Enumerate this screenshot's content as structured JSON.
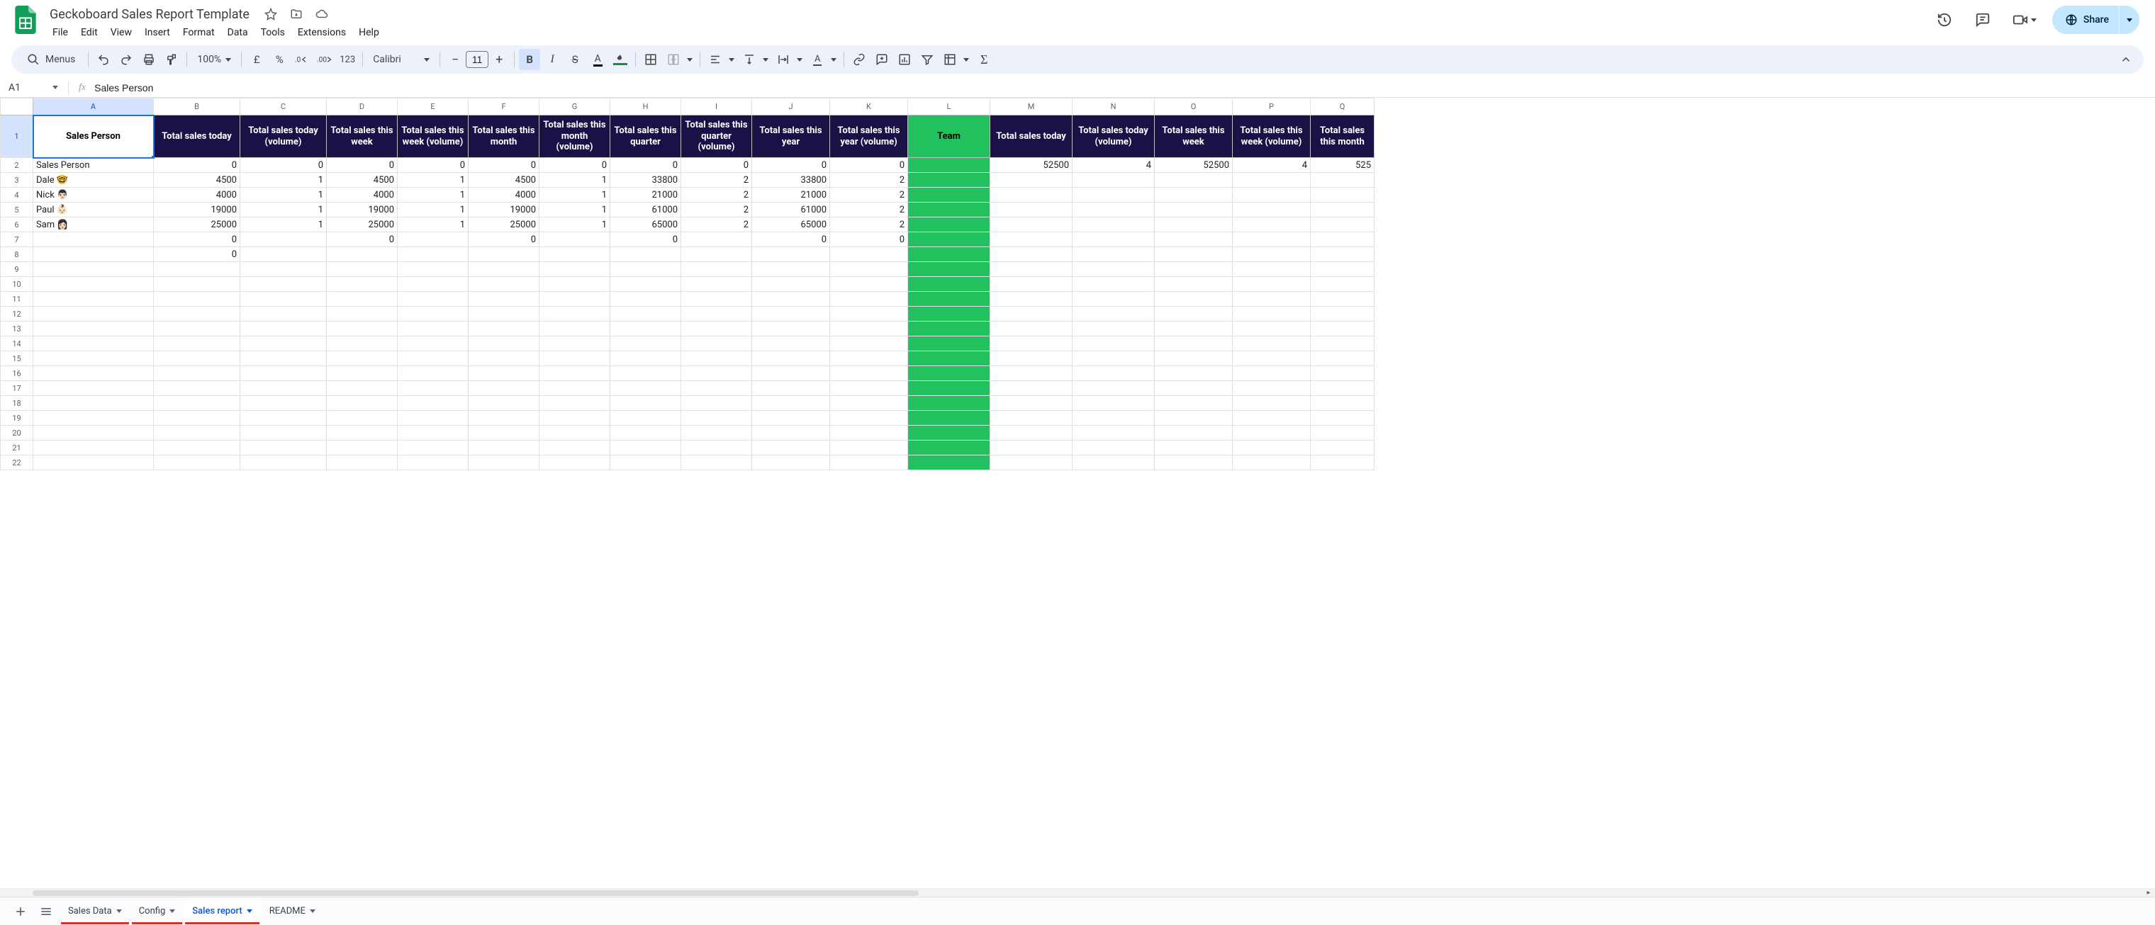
{
  "doc": {
    "title": "Geckoboard Sales Report Template"
  },
  "menus": [
    "File",
    "Edit",
    "View",
    "Insert",
    "Format",
    "Data",
    "Tools",
    "Extensions",
    "Help"
  ],
  "share": {
    "label": "Share"
  },
  "toolbar": {
    "search": "Menus",
    "zoom": "100%",
    "currency": "£",
    "percent": "%",
    "format123": "123",
    "font": "Calibri",
    "font_size": "11"
  },
  "name_box": "A1",
  "formula": "Sales Person",
  "columns": [
    {
      "letter": "A",
      "width": 170,
      "class": "hdr-green",
      "label": "Sales Person"
    },
    {
      "letter": "B",
      "width": 122,
      "class": "hdr-dark",
      "label": "Total sales today"
    },
    {
      "letter": "C",
      "width": 122,
      "class": "hdr-dark",
      "label": "Total sales today (volume)"
    },
    {
      "letter": "D",
      "width": 100,
      "class": "hdr-dark",
      "label": "Total sales this week"
    },
    {
      "letter": "E",
      "width": 100,
      "class": "hdr-dark",
      "label": "Total sales this week (volume)"
    },
    {
      "letter": "F",
      "width": 100,
      "class": "hdr-dark",
      "label": "Total sales this month"
    },
    {
      "letter": "G",
      "width": 100,
      "class": "hdr-dark",
      "label": "Total sales this month (volume)"
    },
    {
      "letter": "H",
      "width": 100,
      "class": "hdr-dark",
      "label": "Total sales this quarter"
    },
    {
      "letter": "I",
      "width": 100,
      "class": "hdr-dark",
      "label": "Total sales this quarter (volume)"
    },
    {
      "letter": "J",
      "width": 110,
      "class": "hdr-dark",
      "label": "Total sales this year"
    },
    {
      "letter": "K",
      "width": 110,
      "class": "hdr-dark",
      "label": "Total sales this year (volume)"
    },
    {
      "letter": "L",
      "width": 116,
      "class": "hdr-green",
      "label": "Team"
    },
    {
      "letter": "M",
      "width": 116,
      "class": "hdr-dark",
      "label": "Total sales today"
    },
    {
      "letter": "N",
      "width": 116,
      "class": "hdr-dark",
      "label": "Total sales today (volume)"
    },
    {
      "letter": "O",
      "width": 110,
      "class": "hdr-dark",
      "label": "Total sales this week"
    },
    {
      "letter": "P",
      "width": 110,
      "class": "hdr-dark",
      "label": "Total sales this week (volume)"
    },
    {
      "letter": "Q",
      "width": 90,
      "class": "hdr-dark",
      "label": "Total sales this month"
    }
  ],
  "green_col_index": 11,
  "rows": [
    {
      "n": 2,
      "cells": [
        "Sales Person",
        "0",
        "0",
        "0",
        "0",
        "0",
        "0",
        "0",
        "0",
        "0",
        "0",
        "",
        "52500",
        "4",
        "52500",
        "4",
        "525"
      ]
    },
    {
      "n": 3,
      "cells": [
        "Dale 🤓",
        "4500",
        "1",
        "4500",
        "1",
        "4500",
        "1",
        "33800",
        "2",
        "33800",
        "2",
        "",
        "",
        "",
        "",
        "",
        ""
      ]
    },
    {
      "n": 4,
      "cells": [
        "Nick 👨🏻",
        "4000",
        "1",
        "4000",
        "1",
        "4000",
        "1",
        "21000",
        "2",
        "21000",
        "2",
        "",
        "",
        "",
        "",
        "",
        ""
      ]
    },
    {
      "n": 5,
      "cells": [
        "Paul 👶🏻",
        "19000",
        "1",
        "19000",
        "1",
        "19000",
        "1",
        "61000",
        "2",
        "61000",
        "2",
        "",
        "",
        "",
        "",
        "",
        ""
      ]
    },
    {
      "n": 6,
      "cells": [
        "Sam 👩🏻",
        "25000",
        "1",
        "25000",
        "1",
        "25000",
        "1",
        "65000",
        "2",
        "65000",
        "2",
        "",
        "",
        "",
        "",
        "",
        ""
      ]
    },
    {
      "n": 7,
      "cells": [
        "",
        "0",
        "",
        "0",
        "",
        "0",
        "",
        "0",
        "",
        "0",
        "0",
        "",
        "",
        "",
        "",
        "",
        ""
      ]
    },
    {
      "n": 8,
      "cells": [
        "",
        "0",
        "",
        "",
        "",
        "",
        "",
        "",
        "",
        "",
        "",
        "",
        "",
        "",
        "",
        "",
        ""
      ]
    },
    {
      "n": 9,
      "cells": [
        "",
        "",
        "",
        "",
        "",
        "",
        "",
        "",
        "",
        "",
        "",
        "",
        "",
        "",
        "",
        "",
        ""
      ]
    },
    {
      "n": 10,
      "cells": [
        "",
        "",
        "",
        "",
        "",
        "",
        "",
        "",
        "",
        "",
        "",
        "",
        "",
        "",
        "",
        "",
        ""
      ]
    },
    {
      "n": 11,
      "cells": [
        "",
        "",
        "",
        "",
        "",
        "",
        "",
        "",
        "",
        "",
        "",
        "",
        "",
        "",
        "",
        "",
        ""
      ]
    },
    {
      "n": 12,
      "cells": [
        "",
        "",
        "",
        "",
        "",
        "",
        "",
        "",
        "",
        "",
        "",
        "",
        "",
        "",
        "",
        "",
        ""
      ]
    },
    {
      "n": 13,
      "cells": [
        "",
        "",
        "",
        "",
        "",
        "",
        "",
        "",
        "",
        "",
        "",
        "",
        "",
        "",
        "",
        "",
        ""
      ]
    },
    {
      "n": 14,
      "cells": [
        "",
        "",
        "",
        "",
        "",
        "",
        "",
        "",
        "",
        "",
        "",
        "",
        "",
        "",
        "",
        "",
        ""
      ]
    },
    {
      "n": 15,
      "cells": [
        "",
        "",
        "",
        "",
        "",
        "",
        "",
        "",
        "",
        "",
        "",
        "",
        "",
        "",
        "",
        "",
        ""
      ]
    },
    {
      "n": 16,
      "cells": [
        "",
        "",
        "",
        "",
        "",
        "",
        "",
        "",
        "",
        "",
        "",
        "",
        "",
        "",
        "",
        "",
        ""
      ]
    },
    {
      "n": 17,
      "cells": [
        "",
        "",
        "",
        "",
        "",
        "",
        "",
        "",
        "",
        "",
        "",
        "",
        "",
        "",
        "",
        "",
        ""
      ]
    },
    {
      "n": 18,
      "cells": [
        "",
        "",
        "",
        "",
        "",
        "",
        "",
        "",
        "",
        "",
        "",
        "",
        "",
        "",
        "",
        "",
        ""
      ]
    },
    {
      "n": 19,
      "cells": [
        "",
        "",
        "",
        "",
        "",
        "",
        "",
        "",
        "",
        "",
        "",
        "",
        "",
        "",
        "",
        "",
        ""
      ]
    },
    {
      "n": 20,
      "cells": [
        "",
        "",
        "",
        "",
        "",
        "",
        "",
        "",
        "",
        "",
        "",
        "",
        "",
        "",
        "",
        "",
        ""
      ]
    },
    {
      "n": 21,
      "cells": [
        "",
        "",
        "",
        "",
        "",
        "",
        "",
        "",
        "",
        "",
        "",
        "",
        "",
        "",
        "",
        "",
        ""
      ]
    },
    {
      "n": 22,
      "cells": [
        "",
        "",
        "",
        "",
        "",
        "",
        "",
        "",
        "",
        "",
        "",
        "",
        "",
        "",
        "",
        "",
        ""
      ]
    }
  ],
  "tabs": [
    {
      "label": "Sales Data",
      "active": false,
      "underline": "red"
    },
    {
      "label": "Config",
      "active": false,
      "underline": "red"
    },
    {
      "label": "Sales report",
      "active": true,
      "underline": "blue"
    },
    {
      "label": "README",
      "active": false,
      "underline": "none"
    }
  ]
}
